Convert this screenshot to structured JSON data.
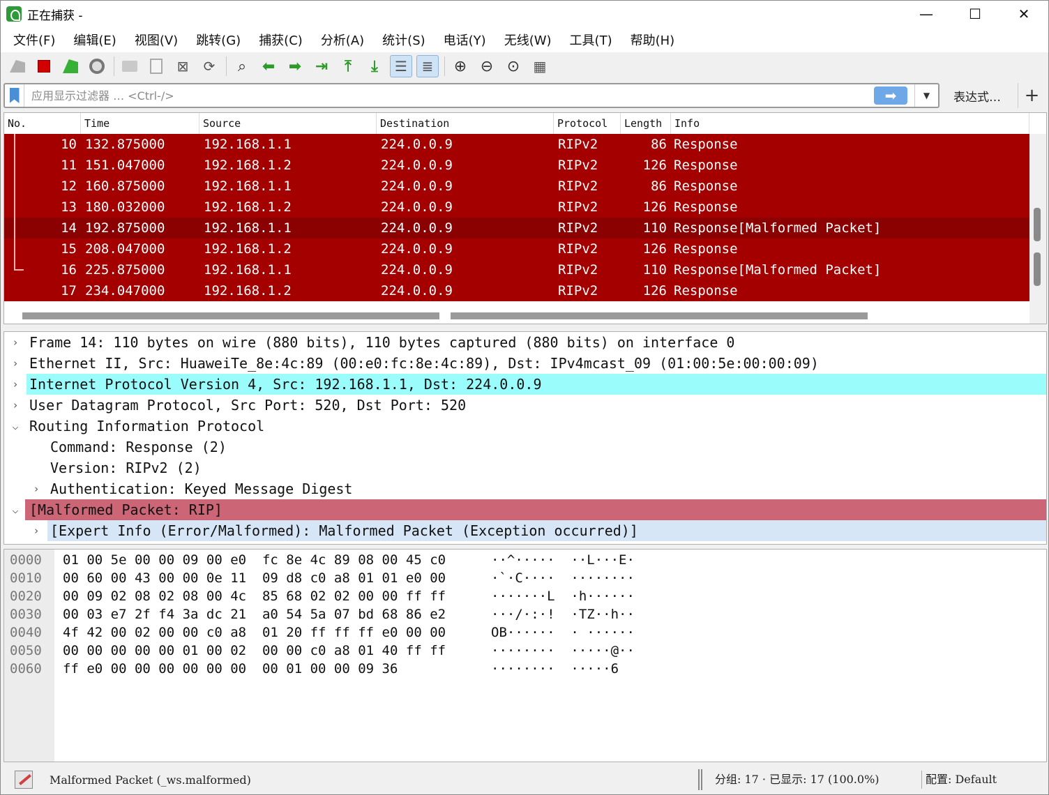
{
  "window": {
    "title": "正在捕获 -",
    "controls": [
      "—",
      "☐",
      "✕"
    ]
  },
  "menu": [
    "文件(F)",
    "编辑(E)",
    "视图(V)",
    "跳转(G)",
    "捕获(C)",
    "分析(A)",
    "统计(S)",
    "电话(Y)",
    "无线(W)",
    "工具(T)",
    "帮助(H)"
  ],
  "toolbar": {
    "icons": [
      "shark-fin-start-icon",
      "stop-capture-icon",
      "restart-capture-icon",
      "capture-options-icon",
      "open-file-icon",
      "save-file-icon",
      "close-file-icon",
      "reload-file-icon",
      "find-packet-icon",
      "go-back-icon",
      "go-forward-icon",
      "go-to-packet-icon",
      "first-packet-icon",
      "last-packet-icon",
      "auto-scroll-icon",
      "colorize-icon",
      "zoom-in-icon",
      "zoom-out-icon",
      "normal-size-icon",
      "resize-columns-icon"
    ]
  },
  "filter": {
    "placeholder": "应用显示过滤器 … <Ctrl-/>",
    "value": "",
    "expression_label": "表达式…",
    "add_label": "+"
  },
  "packet_list": {
    "columns": [
      "No.",
      "Time",
      "Source",
      "Destination",
      "Protocol",
      "Length",
      "Info"
    ],
    "rows": [
      {
        "no": "10",
        "time": "132.875000",
        "src": "192.168.1.1",
        "dst": "224.0.0.9",
        "proto": "RIPv2",
        "len": "86",
        "info": "Response"
      },
      {
        "no": "11",
        "time": "151.047000",
        "src": "192.168.1.2",
        "dst": "224.0.0.9",
        "proto": "RIPv2",
        "len": "126",
        "info": "Response"
      },
      {
        "no": "12",
        "time": "160.875000",
        "src": "192.168.1.1",
        "dst": "224.0.0.9",
        "proto": "RIPv2",
        "len": "86",
        "info": "Response"
      },
      {
        "no": "13",
        "time": "180.032000",
        "src": "192.168.1.2",
        "dst": "224.0.0.9",
        "proto": "RIPv2",
        "len": "126",
        "info": "Response"
      },
      {
        "no": "14",
        "time": "192.875000",
        "src": "192.168.1.1",
        "dst": "224.0.0.9",
        "proto": "RIPv2",
        "len": "110",
        "info": "Response[Malformed Packet]"
      },
      {
        "no": "15",
        "time": "208.047000",
        "src": "192.168.1.2",
        "dst": "224.0.0.9",
        "proto": "RIPv2",
        "len": "126",
        "info": "Response"
      },
      {
        "no": "16",
        "time": "225.875000",
        "src": "192.168.1.1",
        "dst": "224.0.0.9",
        "proto": "RIPv2",
        "len": "110",
        "info": "Response[Malformed Packet]"
      },
      {
        "no": "17",
        "time": "234.047000",
        "src": "192.168.1.2",
        "dst": "224.0.0.9",
        "proto": "RIPv2",
        "len": "126",
        "info": "Response"
      }
    ],
    "selected_no": "14",
    "row_color": "#a40000",
    "selected_row_color": "#8b0000"
  },
  "details": {
    "lines": [
      {
        "text": "Frame 14: 110 bytes on wire (880 bits), 110 bytes captured (880 bits) on interface 0",
        "expand": "collapsed",
        "indent": 0,
        "style": "normal"
      },
      {
        "text": "Ethernet II, Src: HuaweiTe_8e:4c:89 (00:e0:fc:8e:4c:89), Dst: IPv4mcast_09 (01:00:5e:00:00:09)",
        "expand": "collapsed",
        "indent": 0,
        "style": "normal"
      },
      {
        "text": "Internet Protocol Version 4, Src: 192.168.1.1, Dst: 224.0.0.9",
        "expand": "collapsed",
        "indent": 0,
        "style": "cyan"
      },
      {
        "text": "User Datagram Protocol, Src Port: 520, Dst Port: 520",
        "expand": "collapsed",
        "indent": 0,
        "style": "normal"
      },
      {
        "text": "Routing Information Protocol",
        "expand": "expanded",
        "indent": 0,
        "style": "normal"
      },
      {
        "text": "Command: Response (2)",
        "expand": "none",
        "indent": 1,
        "style": "normal"
      },
      {
        "text": "Version: RIPv2 (2)",
        "expand": "none",
        "indent": 1,
        "style": "normal"
      },
      {
        "text": "Authentication: Keyed Message Digest",
        "expand": "collapsed",
        "indent": 1,
        "style": "normal"
      },
      {
        "text": "[Malformed Packet: RIP]",
        "expand": "expanded",
        "indent": 0,
        "style": "malformed"
      },
      {
        "text": "[Expert Info (Error/Malformed): Malformed Packet (Exception occurred)]",
        "expand": "collapsed",
        "indent": 1,
        "style": "expert"
      }
    ]
  },
  "bytes": {
    "rows": [
      {
        "offset": "0000",
        "hex": "01 00 5e 00 00 09 00 e0  fc 8e 4c 89 08 00 45 c0",
        "ascii": "··^·····  ··L···E·"
      },
      {
        "offset": "0010",
        "hex": "00 60 00 43 00 00 0e 11  09 d8 c0 a8 01 01 e0 00",
        "ascii": "·`·C····  ········"
      },
      {
        "offset": "0020",
        "hex": "00 09 02 08 02 08 00 4c  85 68 02 02 00 00 ff ff",
        "ascii": "·······L  ·h······"
      },
      {
        "offset": "0030",
        "hex": "00 03 e7 2f f4 3a dc 21  a0 54 5a 07 bd 68 86 e2",
        "ascii": "···/·:·!  ·TZ··h··"
      },
      {
        "offset": "0040",
        "hex": "4f 42 00 02 00 00 c0 a8  01 20 ff ff ff e0 00 00",
        "ascii": "OB······  · ······"
      },
      {
        "offset": "0050",
        "hex": "00 00 00 00 00 01 00 02  00 00 c0 a8 01 40 ff ff",
        "ascii": "········  ·····@··"
      },
      {
        "offset": "0060",
        "hex": "ff e0 00 00 00 00 00 00  00 01 00 00 09 36",
        "ascii": "········  ·····6"
      }
    ]
  },
  "status": {
    "message": "Malformed Packet (_ws.malformed)",
    "counts": "分组: 17 · 已显示: 17 (100.0%)",
    "profile": "配置: Default"
  }
}
